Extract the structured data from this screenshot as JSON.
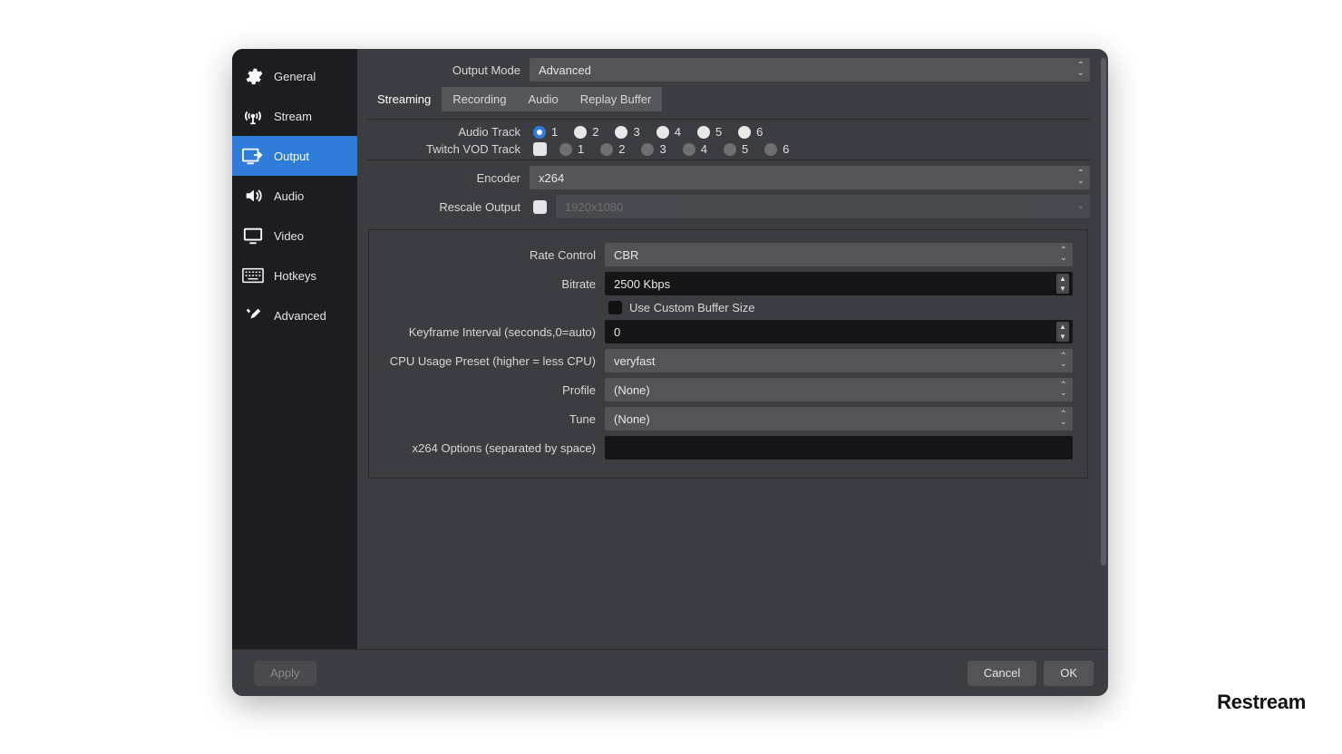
{
  "sidebar": {
    "items": [
      {
        "label": "General"
      },
      {
        "label": "Stream"
      },
      {
        "label": "Output"
      },
      {
        "label": "Audio"
      },
      {
        "label": "Video"
      },
      {
        "label": "Hotkeys"
      },
      {
        "label": "Advanced"
      }
    ],
    "selected_index": 2
  },
  "output_mode": {
    "label": "Output Mode",
    "value": "Advanced"
  },
  "tabs": [
    "Streaming",
    "Recording",
    "Audio",
    "Replay Buffer"
  ],
  "active_tab_index": 0,
  "audio_track": {
    "label": "Audio Track",
    "options": [
      "1",
      "2",
      "3",
      "4",
      "5",
      "6"
    ],
    "selected": "1"
  },
  "twitch_vod": {
    "label": "Twitch VOD Track",
    "enabled": false,
    "options": [
      "1",
      "2",
      "3",
      "4",
      "5",
      "6"
    ]
  },
  "encoder": {
    "label": "Encoder",
    "value": "x264"
  },
  "rescale": {
    "label": "Rescale Output",
    "enabled": false,
    "value": "1920x1080"
  },
  "section": {
    "rate_control": {
      "label": "Rate Control",
      "value": "CBR"
    },
    "bitrate": {
      "label": "Bitrate",
      "value": "2500 Kbps"
    },
    "custom_buffer": {
      "label": "Use Custom Buffer Size",
      "checked": false
    },
    "keyframe": {
      "label": "Keyframe Interval (seconds,0=auto)",
      "value": "0"
    },
    "cpu_preset": {
      "label": "CPU Usage Preset (higher = less CPU)",
      "value": "veryfast"
    },
    "profile": {
      "label": "Profile",
      "value": "(None)"
    },
    "tune": {
      "label": "Tune",
      "value": "(None)"
    },
    "x264opts": {
      "label": "x264 Options (separated by space)",
      "value": ""
    }
  },
  "footer": {
    "apply": "Apply",
    "cancel": "Cancel",
    "ok": "OK"
  },
  "brand": "Restream"
}
